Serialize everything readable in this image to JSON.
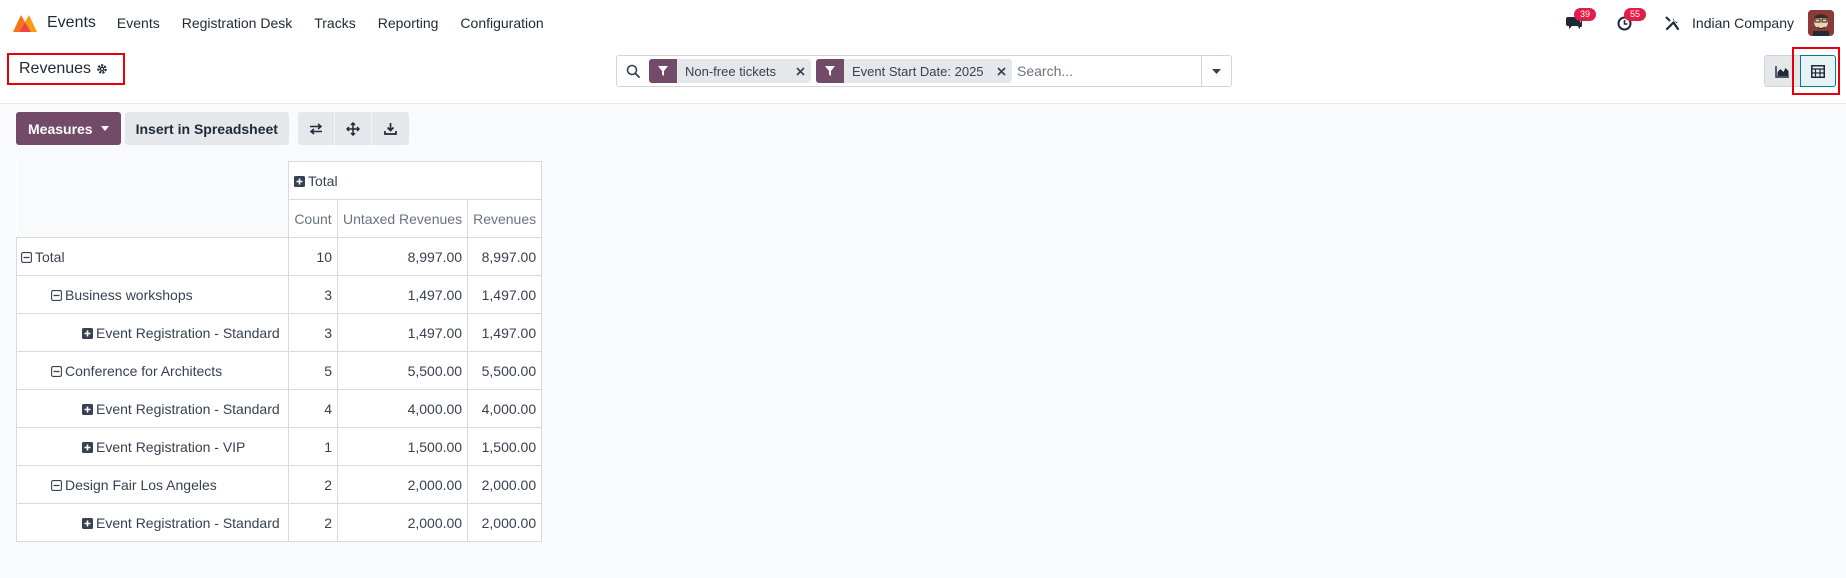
{
  "navbar": {
    "app_name": "Events",
    "menu": [
      "Events",
      "Registration Desk",
      "Tracks",
      "Reporting",
      "Configuration"
    ],
    "messages_badge": "39",
    "activities_badge": "55",
    "company": "Indian Company"
  },
  "control_panel": {
    "title": "Revenues",
    "facets": [
      "Non-free tickets",
      "Event Start Date: 2025"
    ],
    "search_placeholder": "Search..."
  },
  "toolbar": {
    "measures_label": "Measures",
    "spreadsheet_label": "Insert in Spreadsheet"
  },
  "pivot": {
    "col_header": "Total",
    "measures": [
      "Count",
      "Untaxed Revenues",
      "Revenues"
    ],
    "rows": [
      {
        "label": "Total",
        "level": 0,
        "state": "expanded",
        "count": "10",
        "untaxed": "8,997.00",
        "revenues": "8,997.00"
      },
      {
        "label": "Business workshops",
        "level": 1,
        "state": "expanded",
        "count": "3",
        "untaxed": "1,497.00",
        "revenues": "1,497.00"
      },
      {
        "label": "Event Registration - Standard",
        "level": 2,
        "state": "collapsed",
        "count": "3",
        "untaxed": "1,497.00",
        "revenues": "1,497.00"
      },
      {
        "label": "Conference for Architects",
        "level": 1,
        "state": "expanded",
        "count": "5",
        "untaxed": "5,500.00",
        "revenues": "5,500.00"
      },
      {
        "label": "Event Registration - Standard",
        "level": 2,
        "state": "collapsed",
        "count": "4",
        "untaxed": "4,000.00",
        "revenues": "4,000.00"
      },
      {
        "label": "Event Registration - VIP",
        "level": 2,
        "state": "collapsed",
        "count": "1",
        "untaxed": "1,500.00",
        "revenues": "1,500.00"
      },
      {
        "label": "Design Fair Los Angeles",
        "level": 1,
        "state": "expanded",
        "count": "2",
        "untaxed": "2,000.00",
        "revenues": "2,000.00"
      },
      {
        "label": "Event Registration - Standard",
        "level": 2,
        "state": "collapsed",
        "count": "2",
        "untaxed": "2,000.00",
        "revenues": "2,000.00"
      }
    ]
  },
  "colors": {
    "primary": "#714b67",
    "accent": "#017e84",
    "highlight": "#e5000a",
    "badge": "#e11d48"
  }
}
